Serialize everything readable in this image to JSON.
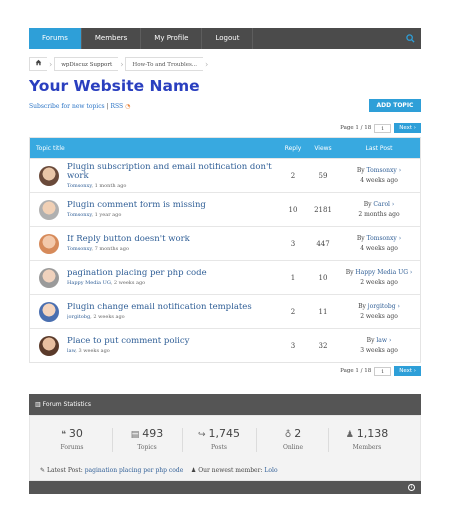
{
  "nav": {
    "items": [
      "Forums",
      "Members",
      "My Profile",
      "Logout"
    ],
    "search_icon": "search-icon"
  },
  "breadcrumb": [
    "wpDiscuz Support",
    "How-To and Troubles..."
  ],
  "site_title": "Your Website Name",
  "subscribe_text": "Subscribe for new topics",
  "rss_text": "RSS",
  "add_topic_label": "ADD TOPIC",
  "pager": {
    "text": "Page 1 / 18",
    "input_value": "1",
    "next_label": "Next"
  },
  "table": {
    "headers": {
      "title": "Topic title",
      "reply": "Reply",
      "views": "Views",
      "last": "Last Post"
    },
    "rows": [
      {
        "title": "Plugin subscription and email notification don't work",
        "author": "Tomsonxy",
        "meta": ", 1 month ago",
        "reply": "2",
        "views": "59",
        "last_user": "Tomsonxy",
        "last_time": "4 weeks ago"
      },
      {
        "title": "Plugin comment form is missing",
        "author": "Tomsonxy",
        "meta": ", 1 year ago",
        "reply": "10",
        "views": "2181",
        "last_user": "Carol",
        "last_time": "2 months ago"
      },
      {
        "title": "If Reply button doesn't work",
        "author": "Tomsonxy",
        "meta": ", 7 months ago",
        "reply": "3",
        "views": "447",
        "last_user": "Tomsonxy",
        "last_time": "4 weeks ago"
      },
      {
        "title": "pagination placing per php code",
        "author": "Happy Media UG",
        "meta": ", 2 weeks ago",
        "reply": "1",
        "views": "10",
        "last_user": "Happy Media UG",
        "last_time": "2 weeks ago"
      },
      {
        "title": "Plugin change email notification templates",
        "author": "jorgitobg",
        "meta": ", 2 weeks ago",
        "reply": "2",
        "views": "11",
        "last_user": "jorgitobg",
        "last_time": "2 weeks ago"
      },
      {
        "title": "Place to put comment policy",
        "author": "law",
        "meta": ", 3 weeks ago",
        "reply": "3",
        "views": "32",
        "last_user": "law",
        "last_time": "3 weeks ago"
      }
    ]
  },
  "stats": {
    "title": "Forum Statistics",
    "items": [
      {
        "value": "30",
        "label": "Forums",
        "icon": "comments-icon"
      },
      {
        "value": "493",
        "label": "Topics",
        "icon": "file-icon"
      },
      {
        "value": "1,745",
        "label": "Posts",
        "icon": "reply-icon"
      },
      {
        "value": "2",
        "label": "Online",
        "icon": "lightbulb-icon"
      },
      {
        "value": "1,138",
        "label": "Members",
        "icon": "user-icon"
      }
    ],
    "latest_label": "Latest Post:",
    "latest_link": "pagination placing per php code",
    "newest_label": "Our newest member:",
    "newest_link": "Lolo"
  }
}
